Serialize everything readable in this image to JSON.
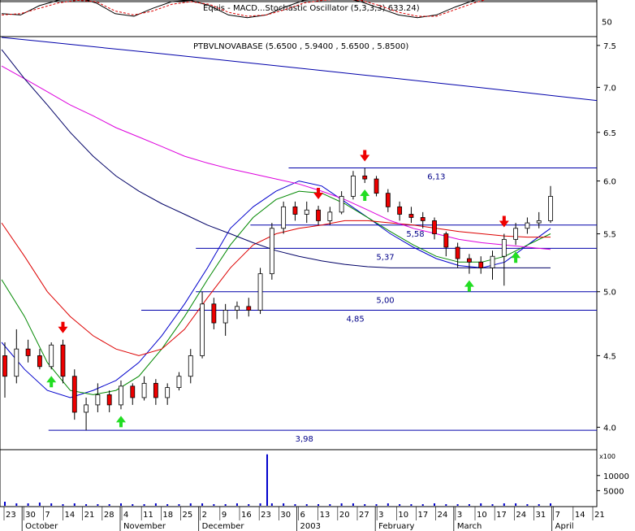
{
  "chart_data": {
    "type": "candlestick",
    "indicator_panel": {
      "label": "Equis - MACD...Stochastic Oscillator (5,3,3,3) 633.24)",
      "axis_ticks": [
        50
      ],
      "k_values": [
        62,
        60,
        74,
        82,
        86,
        78,
        62,
        58,
        70,
        80,
        82,
        74,
        60,
        56,
        60,
        72,
        82,
        84,
        86,
        80,
        70,
        60,
        56,
        60,
        72,
        82,
        90,
        86,
        86,
        86
      ],
      "d_values": [
        60,
        62,
        70,
        78,
        82,
        80,
        66,
        60,
        66,
        76,
        80,
        76,
        64,
        58,
        60,
        68,
        78,
        82,
        84,
        82,
        74,
        64,
        58,
        58,
        68,
        78,
        86,
        86,
        86,
        86
      ],
      "ylim": [
        30,
        80
      ],
      "levels": [
        80,
        20
      ]
    },
    "price_panel": {
      "title": "PTBVLNOVABASE (5.6500 , 5.9400 , 5.6500 , 5.8500)",
      "y_ticks": [
        "7.5",
        "7.0",
        "6.5",
        "6.0",
        "5.5",
        "5.0",
        "4.5",
        "4.0"
      ],
      "ylim": [
        3.86,
        7.6
      ],
      "log_scale": true,
      "horizontal_levels": [
        {
          "value": 6.13,
          "label": "6,13"
        },
        {
          "value": 5.58,
          "label": "5,58"
        },
        {
          "value": 5.37,
          "label": "5,37"
        },
        {
          "value": 5.0,
          "label": "5,00"
        },
        {
          "value": 4.85,
          "label": "4,85"
        },
        {
          "value": 3.98,
          "label": "3,98"
        }
      ],
      "candles": [
        {
          "o": 4.5,
          "h": 4.6,
          "l": 4.2,
          "c": 4.35
        },
        {
          "o": 4.35,
          "h": 4.7,
          "l": 4.3,
          "c": 4.55
        },
        {
          "o": 4.55,
          "h": 4.62,
          "l": 4.45,
          "c": 4.5
        },
        {
          "o": 4.5,
          "h": 4.55,
          "l": 4.4,
          "c": 4.42
        },
        {
          "o": 4.42,
          "h": 4.6,
          "l": 4.4,
          "c": 4.58
        },
        {
          "o": 4.58,
          "h": 4.62,
          "l": 4.3,
          "c": 4.35
        },
        {
          "o": 4.35,
          "h": 4.4,
          "l": 4.05,
          "c": 4.1
        },
        {
          "o": 4.1,
          "h": 4.2,
          "l": 3.98,
          "c": 4.15
        },
        {
          "o": 4.15,
          "h": 4.3,
          "l": 4.1,
          "c": 4.22
        },
        {
          "o": 4.22,
          "h": 4.25,
          "l": 4.1,
          "c": 4.15
        },
        {
          "o": 4.15,
          "h": 4.32,
          "l": 4.12,
          "c": 4.28
        },
        {
          "o": 4.28,
          "h": 4.3,
          "l": 4.15,
          "c": 4.2
        },
        {
          "o": 4.2,
          "h": 4.35,
          "l": 4.18,
          "c": 4.3
        },
        {
          "o": 4.3,
          "h": 4.33,
          "l": 4.15,
          "c": 4.2
        },
        {
          "o": 4.2,
          "h": 4.3,
          "l": 4.15,
          "c": 4.27
        },
        {
          "o": 4.27,
          "h": 4.38,
          "l": 4.25,
          "c": 4.35
        },
        {
          "o": 4.35,
          "h": 4.55,
          "l": 4.3,
          "c": 4.5
        },
        {
          "o": 4.5,
          "h": 5.0,
          "l": 4.48,
          "c": 4.9
        },
        {
          "o": 4.9,
          "h": 4.95,
          "l": 4.7,
          "c": 4.75
        },
        {
          "o": 4.75,
          "h": 4.9,
          "l": 4.65,
          "c": 4.85
        },
        {
          "o": 4.85,
          "h": 4.92,
          "l": 4.78,
          "c": 4.88
        },
        {
          "o": 4.88,
          "h": 4.95,
          "l": 4.8,
          "c": 4.85
        },
        {
          "o": 4.85,
          "h": 5.2,
          "l": 4.82,
          "c": 5.15
        },
        {
          "o": 5.15,
          "h": 5.6,
          "l": 5.1,
          "c": 5.55
        },
        {
          "o": 5.55,
          "h": 5.8,
          "l": 5.5,
          "c": 5.75
        },
        {
          "o": 5.75,
          "h": 5.8,
          "l": 5.62,
          "c": 5.68
        },
        {
          "o": 5.68,
          "h": 5.8,
          "l": 5.6,
          "c": 5.72
        },
        {
          "o": 5.72,
          "h": 5.76,
          "l": 5.58,
          "c": 5.62
        },
        {
          "o": 5.62,
          "h": 5.75,
          "l": 5.58,
          "c": 5.7
        },
        {
          "o": 5.7,
          "h": 5.9,
          "l": 5.68,
          "c": 5.85
        },
        {
          "o": 5.85,
          "h": 6.1,
          "l": 5.82,
          "c": 6.05
        },
        {
          "o": 6.05,
          "h": 6.13,
          "l": 5.98,
          "c": 6.02
        },
        {
          "o": 6.02,
          "h": 6.05,
          "l": 5.85,
          "c": 5.88
        },
        {
          "o": 5.88,
          "h": 5.92,
          "l": 5.7,
          "c": 5.75
        },
        {
          "o": 5.75,
          "h": 5.8,
          "l": 5.62,
          "c": 5.68
        },
        {
          "o": 5.68,
          "h": 5.75,
          "l": 5.6,
          "c": 5.65
        },
        {
          "o": 5.65,
          "h": 5.7,
          "l": 5.55,
          "c": 5.62
        },
        {
          "o": 5.62,
          "h": 5.65,
          "l": 5.45,
          "c": 5.5
        },
        {
          "o": 5.5,
          "h": 5.52,
          "l": 5.3,
          "c": 5.38
        },
        {
          "o": 5.38,
          "h": 5.42,
          "l": 5.2,
          "c": 5.28
        },
        {
          "o": 5.28,
          "h": 5.32,
          "l": 5.15,
          "c": 5.25
        },
        {
          "o": 5.25,
          "h": 5.3,
          "l": 5.15,
          "c": 5.2
        },
        {
          "o": 5.2,
          "h": 5.35,
          "l": 5.1,
          "c": 5.3
        },
        {
          "o": 5.3,
          "h": 5.5,
          "l": 5.05,
          "c": 5.45
        },
        {
          "o": 5.45,
          "h": 5.6,
          "l": 5.4,
          "c": 5.55
        },
        {
          "o": 5.55,
          "h": 5.65,
          "l": 5.5,
          "c": 5.6
        },
        {
          "o": 5.6,
          "h": 5.7,
          "l": 5.55,
          "c": 5.62
        },
        {
          "o": 5.62,
          "h": 5.95,
          "l": 5.6,
          "c": 5.85
        }
      ],
      "moving_averages": [
        {
          "color": "#0000cc",
          "values": [
            4.6,
            4.4,
            4.25,
            4.2,
            4.25,
            4.32,
            4.45,
            4.65,
            4.9,
            5.2,
            5.55,
            5.75,
            5.9,
            6.0,
            5.95,
            5.8,
            5.65,
            5.5,
            5.38,
            5.28,
            5.22,
            5.2,
            5.25,
            5.4,
            5.55
          ]
        },
        {
          "color": "#008800",
          "values": [
            5.1,
            4.8,
            4.45,
            4.25,
            4.22,
            4.25,
            4.35,
            4.55,
            4.8,
            5.1,
            5.4,
            5.65,
            5.82,
            5.9,
            5.88,
            5.78,
            5.65,
            5.52,
            5.4,
            5.3,
            5.25,
            5.25,
            5.3,
            5.4,
            5.5
          ]
        },
        {
          "color": "#dd0000",
          "values": [
            5.6,
            5.3,
            5.0,
            4.8,
            4.65,
            4.55,
            4.5,
            4.55,
            4.7,
            4.95,
            5.2,
            5.4,
            5.5,
            5.55,
            5.58,
            5.62,
            5.62,
            5.6,
            5.58,
            5.55,
            5.52,
            5.5,
            5.48,
            5.47,
            5.47
          ]
        },
        {
          "color": "#dd00dd",
          "values": [
            7.25,
            7.1,
            6.95,
            6.8,
            6.68,
            6.55,
            6.45,
            6.35,
            6.25,
            6.18,
            6.12,
            6.07,
            6.02,
            5.97,
            5.9,
            5.82,
            5.72,
            5.62,
            5.55,
            5.5,
            5.45,
            5.42,
            5.4,
            5.38,
            5.36
          ]
        },
        {
          "color": "#000066",
          "values": [
            7.45,
            7.1,
            6.8,
            6.5,
            6.25,
            6.05,
            5.9,
            5.78,
            5.68,
            5.58,
            5.5,
            5.42,
            5.35,
            5.3,
            5.26,
            5.23,
            5.21,
            5.2,
            5.2,
            5.2,
            5.2,
            5.2,
            5.2,
            5.2,
            5.2
          ]
        },
        {
          "color": "#0000aa",
          "values": [
            7.6,
            7.55,
            7.5,
            7.45,
            7.4,
            7.35,
            7.3,
            7.25,
            7.2,
            7.15,
            7.1,
            7.05,
            7.0,
            6.95,
            6.9,
            6.85
          ]
        }
      ],
      "buy_signals": [
        4,
        10,
        31,
        40,
        44
      ],
      "sell_signals": [
        5,
        27,
        31,
        43
      ]
    },
    "volume_panel": {
      "label": "x100",
      "y_ticks": [
        "10000",
        "5000"
      ],
      "values": [
        5,
        3,
        3,
        4,
        3,
        2,
        3,
        2,
        2,
        2,
        3,
        2,
        2,
        3,
        2,
        2,
        3,
        3,
        2,
        2,
        3,
        2,
        3,
        3,
        3,
        2,
        2,
        2,
        2,
        3,
        3,
        2,
        2,
        3,
        2,
        2,
        2,
        3,
        2,
        2,
        2,
        3,
        2,
        3,
        3,
        2,
        2,
        3
      ],
      "spike": 17000
    },
    "x_axis": {
      "day_ticks": [
        "23",
        "30",
        "7",
        "14",
        "21",
        "28",
        "4",
        "11",
        "18",
        "25",
        "2",
        "9",
        "16",
        "23",
        "30",
        "6",
        "13",
        "20",
        "27",
        "3",
        "10",
        "17",
        "24",
        "3",
        "10",
        "17",
        "24",
        "31",
        "7",
        "14",
        "21"
      ],
      "month_labels": [
        "October",
        "November",
        "December",
        "2003",
        "February",
        "March",
        "April"
      ]
    }
  }
}
